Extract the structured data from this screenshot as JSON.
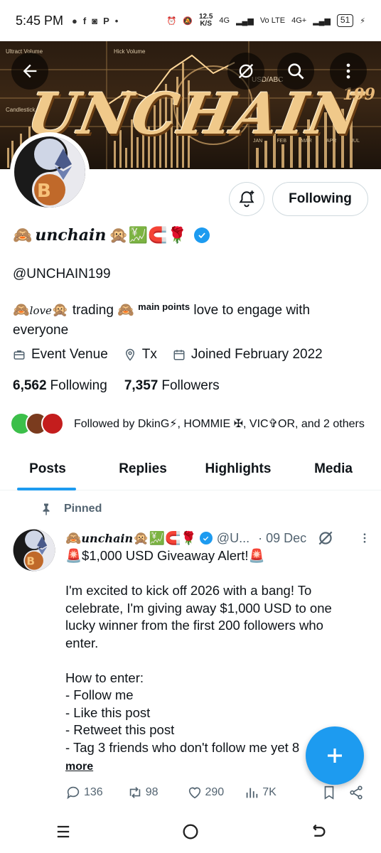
{
  "status_bar": {
    "time": "5:45 PM",
    "speed_value": "12.5",
    "speed_unit": "K/S",
    "network_1": "4G",
    "network_2": "Vo LTE",
    "network_3": "4G+",
    "battery": "51"
  },
  "banner": {
    "title": "UNCHAIN",
    "suffix": "199",
    "label_a": "Ultract Volume",
    "label_b": "Hick Volume",
    "label_c": "Candlestick",
    "label_d": "USD/ABC",
    "months": [
      "JAN",
      "FEB",
      "MAR",
      "APR",
      "JUL"
    ]
  },
  "header_icons": {
    "back": "arrow-left-icon",
    "grok": "grok-icon",
    "search": "search-icon",
    "more": "more-vertical-icon"
  },
  "profile": {
    "display_name": "unchain",
    "name_prefix_emoji": "🙈",
    "name_suffix_emojis": "🙊💹🧲🌹",
    "handle": "@UNCHAIN199",
    "bio_emoji_1": "🙈",
    "bio_love": "love",
    "bio_emoji_2": "🙊",
    "bio_word_1": "trading",
    "bio_emoji_3": "🙈",
    "bio_sup": "main points",
    "bio_rest": "love to engage with everyone",
    "location_venue": "Event Venue",
    "location": "Tx",
    "joined": "Joined February 2022",
    "following_count": "6,562",
    "following_label": "Following",
    "followers_count": "7,357",
    "followers_label": "Followers",
    "followed_by": "Followed by DkinG⚡, HOMMIE ✠, VIC✞OR, and 2 others"
  },
  "buttons": {
    "following": "Following"
  },
  "tabs": [
    {
      "label": "Posts",
      "active": true
    },
    {
      "label": "Replies",
      "active": false
    },
    {
      "label": "Highlights",
      "active": false
    },
    {
      "label": "Media",
      "active": false
    }
  ],
  "post": {
    "pinned_label": "Pinned",
    "author_prefix": "🙈",
    "author_name": "unchain",
    "author_suffix": "🙊💹🧲🌹",
    "handle": "@U...",
    "date": "· 09 Dec",
    "body": "🚨$1,000 USD Giveaway Alert!🚨\n\nI'm excited to kick off 2026 with a bang! To celebrate, I'm giving away $1,000 USD to one lucky winner from the first 200 followers who enter.\n\nHow to enter:\n- Follow me\n- Like this post\n- Retweet this post\n- Tag 3 friends who don't follow me yet 8",
    "more_label": "more",
    "replies": "136",
    "reposts": "98",
    "likes": "290",
    "views": "7K"
  },
  "colors": {
    "accent": "#1d9bf0",
    "text": "#0f1419",
    "muted": "#536471",
    "border": "#cfd9de"
  }
}
